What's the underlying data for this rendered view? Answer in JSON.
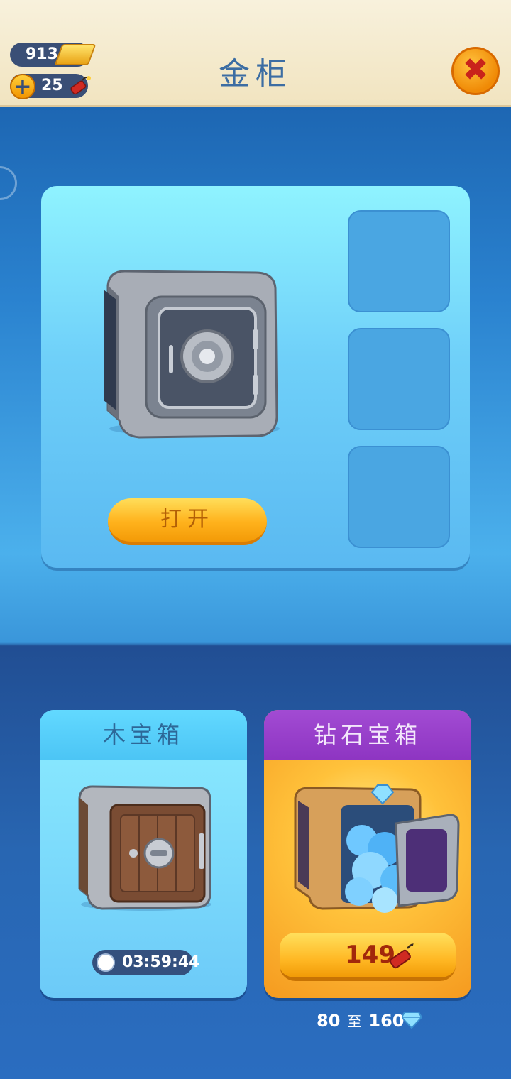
{
  "header": {
    "title": "金柜",
    "gold_count": "913",
    "dynamite_count": "25",
    "plus_label": "+",
    "close_label": "✖"
  },
  "vault": {
    "open_button_label": "打开",
    "slots": [
      "",
      "",
      ""
    ]
  },
  "wood_chest": {
    "title": "木宝箱",
    "timer": "03:59:44"
  },
  "diamond_chest": {
    "title": "钻石宝箱",
    "price": "149",
    "reward_min": "80",
    "reward_separator": "至",
    "reward_max": "160"
  },
  "icons": {
    "gold": "gold-bar-icon",
    "dynamite": "dynamite-icon",
    "clock": "clock-icon",
    "gem": "diamond-icon"
  },
  "colors": {
    "accent_orange": "#ffb21c",
    "header_bg": "#f3e6c4",
    "panel_blue": "#6fd0f9",
    "diamond_purple": "#9a42cc"
  }
}
